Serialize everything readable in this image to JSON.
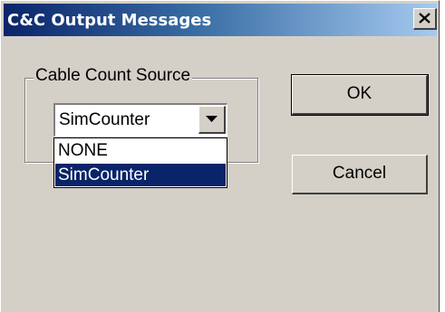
{
  "window": {
    "title": "C&C Output Messages"
  },
  "group": {
    "label": "Cable Count Source"
  },
  "combo": {
    "selected": "SimCounter",
    "options": [
      "NONE",
      "SimCounter"
    ]
  },
  "buttons": {
    "ok_label": "OK",
    "cancel_label": "Cancel"
  },
  "icons": {
    "close": "close-icon",
    "dropdown": "chevron-down-icon"
  },
  "colors": {
    "title_start": "#0a246a",
    "title_end": "#a6caf0",
    "selection": "#0a246a",
    "face": "#d4d0c8"
  }
}
